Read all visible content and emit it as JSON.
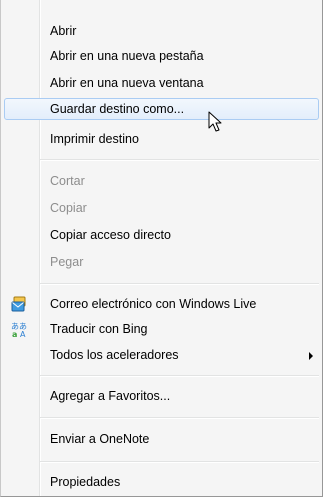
{
  "menu": {
    "items": [
      {
        "label": "Abrir",
        "state": "normal"
      },
      {
        "label": "Abrir en una nueva pestaña",
        "state": "normal"
      },
      {
        "label": "Abrir en una nueva ventana",
        "state": "normal"
      },
      {
        "label": "Guardar destino como...",
        "state": "selected"
      },
      {
        "label": "Imprimir destino",
        "state": "normal"
      },
      {
        "label": "Cortar",
        "state": "disabled"
      },
      {
        "label": "Copiar",
        "state": "disabled"
      },
      {
        "label": "Copiar acceso directo",
        "state": "normal"
      },
      {
        "label": "Pegar",
        "state": "disabled"
      },
      {
        "label": "Correo electrónico con Windows Live",
        "state": "normal",
        "icon": "windows-live-mail-icon"
      },
      {
        "label": "Traducir con Bing",
        "state": "normal",
        "icon": "bing-translator-icon"
      },
      {
        "label": "Todos los aceleradores",
        "state": "normal",
        "submenu": true
      },
      {
        "label": "Agregar a Favoritos...",
        "state": "normal"
      },
      {
        "label": "Enviar a OneNote",
        "state": "normal"
      },
      {
        "label": "Propiedades",
        "state": "normal"
      }
    ]
  },
  "colors": {
    "menu_background": "#f5f5f5",
    "selection_fill": "#e3eefb",
    "selection_border": "#aaccf3",
    "disabled_text": "#8d8d8d"
  }
}
